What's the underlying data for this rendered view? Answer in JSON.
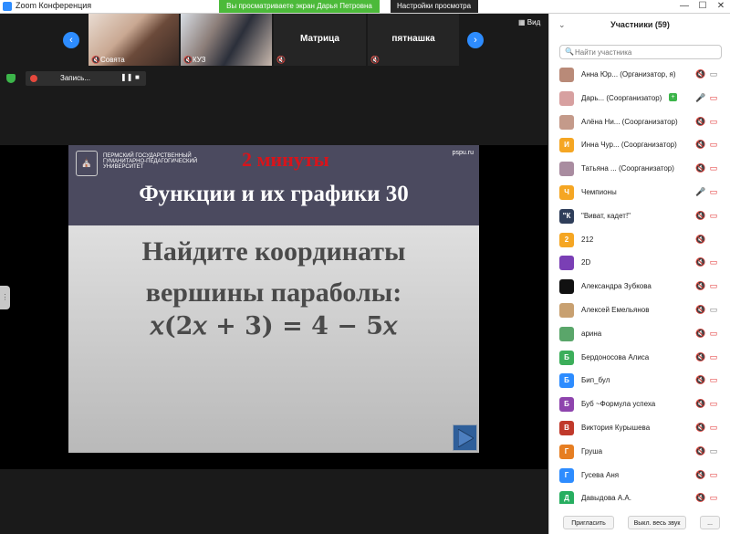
{
  "window": {
    "title": "Zoom Конференция",
    "share_banner": "Вы просматриваете экран Дарья Петровна",
    "view_options": "Настройки просмотра ⌄"
  },
  "thumbnails": [
    {
      "name": "Совята",
      "kind": "photo"
    },
    {
      "name": "КУЗ",
      "kind": "photo"
    },
    {
      "name": "Матрица",
      "kind": "text"
    },
    {
      "name": "пятнашка",
      "kind": "text"
    }
  ],
  "view_button": "Вид",
  "recording": {
    "label": "Запись...",
    "pause": "❚❚",
    "stop": "■"
  },
  "slide": {
    "university": "ПЕРМСКИЙ ГОСУДАРСТВЕННЫЙ ГУМАНИТАРНО-ПЕДАГОГИЧЕСКИЙ УНИВЕРСИТЕТ",
    "site": "pspu.ru",
    "timer": "2 минуты",
    "title": "Функции и их графики 30",
    "line1": "Найдите координаты",
    "line2": "вершины параболы:",
    "equation": "𝑥(2𝑥 + 3) = 4 − 5𝑥"
  },
  "panel": {
    "title": "Участники (59)",
    "search_placeholder": "Найти участника",
    "footer": {
      "invite": "Пригласить",
      "mute_all": "Выкл. весь звук",
      "more": "..."
    }
  },
  "participants": [
    {
      "avatar": "",
      "color": "#b98a78",
      "name": "Анна Юр... (Организатор, я)",
      "badge": false,
      "mic": "🔇",
      "mic_color": "red",
      "cam": "▭",
      "cam_color": "grey"
    },
    {
      "avatar": "",
      "color": "#d7a0a0",
      "name": "Дарь... (Соорганизатор)",
      "badge": true,
      "mic": "🎤",
      "mic_color": "grey",
      "cam": "▭",
      "cam_color": "red"
    },
    {
      "avatar": "",
      "color": "#c49a8a",
      "name": "Алёна Ни... (Соорганизатор)",
      "badge": false,
      "mic": "🔇",
      "mic_color": "red",
      "cam": "▭",
      "cam_color": "red"
    },
    {
      "avatar": "И",
      "color": "#f5a623",
      "name": "Инна Чур... (Соорганизатор)",
      "badge": false,
      "mic": "🔇",
      "mic_color": "red",
      "cam": "▭",
      "cam_color": "red"
    },
    {
      "avatar": "",
      "color": "#a98ca0",
      "name": "Татьяна ... (Соорганизатор)",
      "badge": false,
      "mic": "🔇",
      "mic_color": "red",
      "cam": "▭",
      "cam_color": "red"
    },
    {
      "avatar": "Ч",
      "color": "#f5a623",
      "name": "Чемпионы",
      "badge": false,
      "mic": "🎤",
      "mic_color": "grey",
      "cam": "▭",
      "cam_color": "red"
    },
    {
      "avatar": "\"К",
      "color": "#2f3e5a",
      "name": "\"Виват, кадет!\"",
      "badge": false,
      "mic": "🔇",
      "mic_color": "red",
      "cam": "▭",
      "cam_color": "red"
    },
    {
      "avatar": "2",
      "color": "#f5a623",
      "name": "212",
      "badge": false,
      "mic": "🔇",
      "mic_color": "red",
      "cam": "",
      "cam_color": "grey"
    },
    {
      "avatar": "",
      "color": "#7a3fb5",
      "name": "2D",
      "badge": false,
      "mic": "🔇",
      "mic_color": "red",
      "cam": "▭",
      "cam_color": "red"
    },
    {
      "avatar": "",
      "color": "#111111",
      "name": "Александра Зубкова",
      "badge": false,
      "mic": "🔇",
      "mic_color": "red",
      "cam": "▭",
      "cam_color": "red"
    },
    {
      "avatar": "",
      "color": "#c8a070",
      "name": "Алексей Емельянов",
      "badge": false,
      "mic": "🔇",
      "mic_color": "red",
      "cam": "▭",
      "cam_color": "grey"
    },
    {
      "avatar": "",
      "color": "#5aa66a",
      "name": "арина",
      "badge": false,
      "mic": "🔇",
      "mic_color": "red",
      "cam": "▭",
      "cam_color": "red"
    },
    {
      "avatar": "Б",
      "color": "#3cae5a",
      "name": "Бердоносова Алиса",
      "badge": false,
      "mic": "🔇",
      "mic_color": "red",
      "cam": "▭",
      "cam_color": "red"
    },
    {
      "avatar": "Б",
      "color": "#2d8cff",
      "name": "Бип_бул",
      "badge": false,
      "mic": "🔇",
      "mic_color": "red",
      "cam": "▭",
      "cam_color": "red"
    },
    {
      "avatar": "Б",
      "color": "#8e44ad",
      "name": "Буб ~Формула успеха",
      "badge": false,
      "mic": "🔇",
      "mic_color": "red",
      "cam": "▭",
      "cam_color": "red"
    },
    {
      "avatar": "В",
      "color": "#c0392b",
      "name": "Виктория Курышева",
      "badge": false,
      "mic": "🔇",
      "mic_color": "red",
      "cam": "▭",
      "cam_color": "red"
    },
    {
      "avatar": "Г",
      "color": "#e67e22",
      "name": "Груша",
      "badge": false,
      "mic": "🔇",
      "mic_color": "red",
      "cam": "▭",
      "cam_color": "grey"
    },
    {
      "avatar": "Г",
      "color": "#2d8cff",
      "name": "Гусева Аня",
      "badge": false,
      "mic": "🔇",
      "mic_color": "red",
      "cam": "▭",
      "cam_color": "red"
    },
    {
      "avatar": "Д",
      "color": "#27ae60",
      "name": "Давыдова А.А.",
      "badge": false,
      "mic": "🔇",
      "mic_color": "red",
      "cam": "▭",
      "cam_color": "red"
    }
  ]
}
